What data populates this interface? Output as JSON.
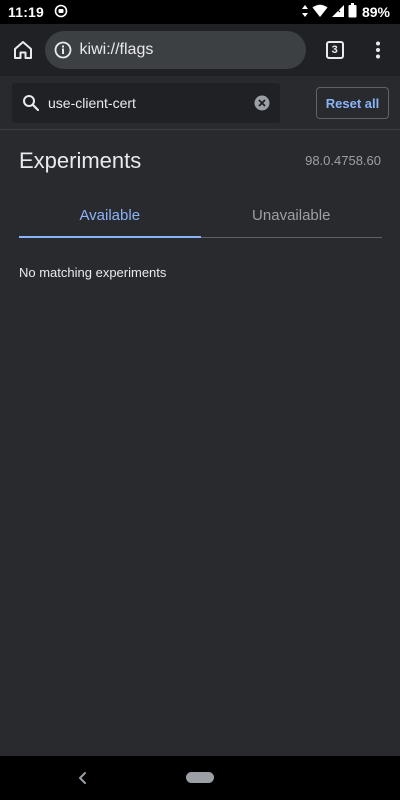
{
  "status_bar": {
    "time": "11:19",
    "battery_percent": "89%",
    "icons": [
      "notification-icon",
      "data-arrows-icon",
      "wifi-icon",
      "signal-icon",
      "battery-icon"
    ]
  },
  "toolbar": {
    "url": "kiwi://flags",
    "tab_count": "3",
    "icons": [
      "home-icon",
      "info-icon",
      "more-vert-icon"
    ]
  },
  "search": {
    "value": "use-client-cert",
    "icons": [
      "search-icon",
      "clear-icon"
    ]
  },
  "reset_button": {
    "label": "Reset all"
  },
  "page": {
    "title": "Experiments",
    "version": "98.0.4758.60"
  },
  "tabs": [
    {
      "label": "Available",
      "active": true
    },
    {
      "label": "Unavailable",
      "active": false
    }
  ],
  "empty_message": "No matching experiments",
  "colors": {
    "background": "#292a2d",
    "toolbar": "#202124",
    "omnibox": "#3c4043",
    "accent": "#8ab4f8",
    "text_primary": "#e8eaed",
    "text_secondary": "#9aa0a6"
  }
}
